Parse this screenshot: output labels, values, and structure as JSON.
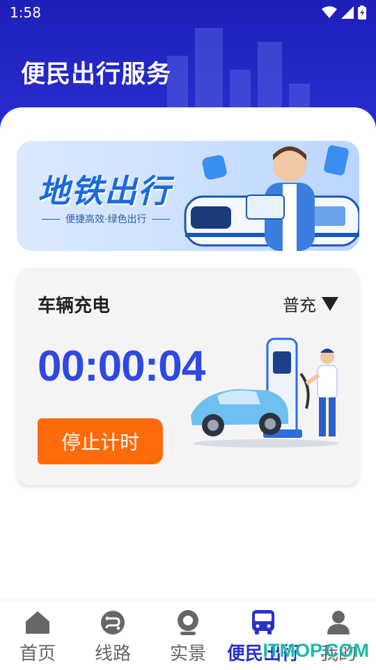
{
  "status_bar": {
    "time": "1:58"
  },
  "header": {
    "title": "便民出行服务"
  },
  "banner": {
    "title": "地铁出行",
    "subtitle": "便捷高效·绿色出行"
  },
  "charging": {
    "title": "车辆充电",
    "mode": "普充",
    "timer": "00:00:04",
    "stop_label": "停止计时"
  },
  "nav": {
    "items": [
      {
        "label": "首页",
        "icon": "home-icon",
        "active": false
      },
      {
        "label": "线路",
        "icon": "route-icon",
        "active": false
      },
      {
        "label": "实景",
        "icon": "location-icon",
        "active": false
      },
      {
        "label": "便民出行",
        "icon": "bus-icon",
        "active": true
      },
      {
        "label": "我的",
        "icon": "person-icon",
        "active": false
      }
    ]
  },
  "watermark": "ITMOP.COM",
  "colors": {
    "header": "#1e1fb8",
    "accent": "#2f49e0",
    "button": "#ff6a0a",
    "nav_active": "#2a31c8"
  }
}
